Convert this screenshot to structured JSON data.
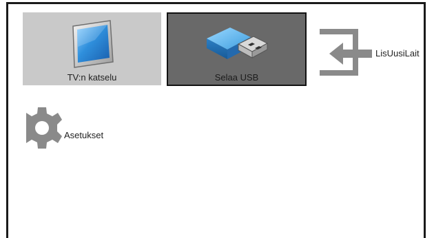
{
  "home_menu": {
    "tiles": [
      {
        "label": "TV:n katselu",
        "icon": "tv-icon",
        "selected": false
      },
      {
        "label": "Selaa USB",
        "icon": "usb-stick-icon",
        "selected": true
      }
    ],
    "add_device": {
      "label": "LisUusiLait",
      "icon": "add-device-arrow-icon"
    },
    "settings": {
      "label": "Asetukset",
      "icon": "gear-icon"
    }
  },
  "colors": {
    "tile_background": "#c9c9c9",
    "selected_tile_background": "#696969",
    "icon_gray": "#8a8a8a",
    "tv_screen_blue": "#2f8fdc",
    "usb_blue": "#3f9edf",
    "frame": "#1a1a1a"
  }
}
